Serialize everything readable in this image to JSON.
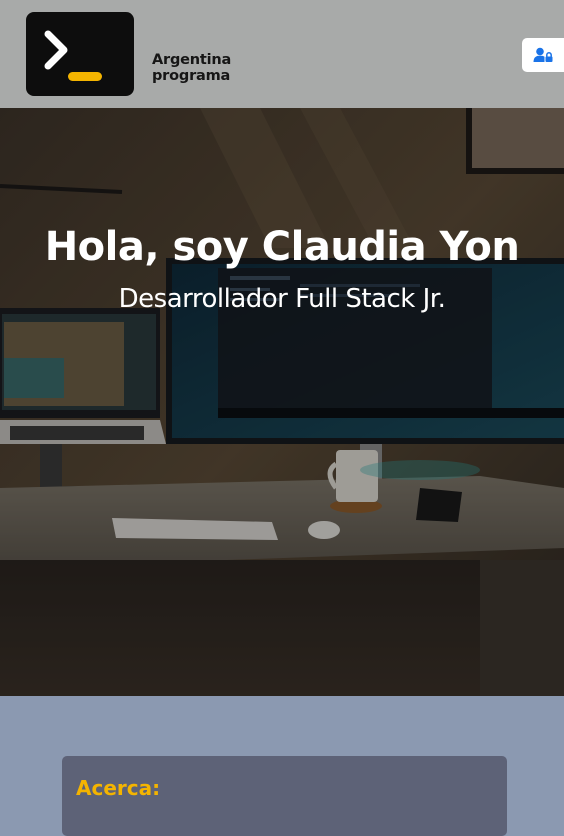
{
  "header": {
    "brand_line1": "Argentina",
    "brand_line2": "programa",
    "logo_icon": "terminal-prompt-icon",
    "user_icon": "user-lock-icon",
    "colors": {
      "background": "#a8aaa9",
      "logo_bg": "#0d0d0d",
      "logo_accent": "#f4b400",
      "user_icon": "#1a73e8"
    }
  },
  "hero": {
    "title": "Hola, soy Claudia Yon",
    "subtitle": "Desarrollador Full Stack Jr."
  },
  "about": {
    "title": "Acerca:",
    "colors": {
      "title": "#f4b400",
      "card": "#5d6277",
      "section_bg": "#8b99b1"
    }
  }
}
